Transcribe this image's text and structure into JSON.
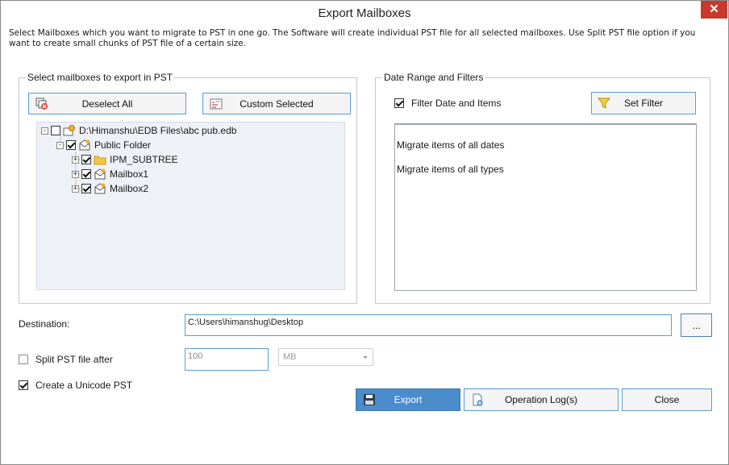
{
  "window": {
    "title": "Export Mailboxes",
    "close_glyph": "✕"
  },
  "description": "Select Mailboxes which you want to migrate to PST in one go. The Software will create individual PST file for all selected mailboxes. Use Split PST file option if you want to create small chunks of PST file of a certain size.",
  "left_group": {
    "legend": "Select mailboxes to export in PST",
    "deselect_label": "Deselect All",
    "deselect_icon": "deselect-icon",
    "custom_label": "Custom Selected",
    "custom_icon": "custom-select-icon",
    "tree": [
      {
        "label": "D:\\Himanshu\\EDB Files\\abc pub.edb",
        "expander": "-",
        "checked": false,
        "icon": "database-icon"
      },
      {
        "label": "Public Folder",
        "expander": "-",
        "checked": true,
        "icon": "mailbox-icon"
      },
      {
        "label": "IPM_SUBTREE",
        "expander": "+",
        "checked": true,
        "icon": "folder-icon"
      },
      {
        "label": "Mailbox1",
        "expander": "+",
        "checked": true,
        "icon": "mailbox-icon"
      },
      {
        "label": "Mailbox2",
        "expander": "+",
        "checked": true,
        "icon": "mailbox-icon"
      }
    ]
  },
  "right_group": {
    "legend": "Date Range and Filters",
    "filter_checkbox_label": "Filter Date and Items",
    "filter_checked": true,
    "set_filter_label": "Set Filter",
    "set_filter_icon": "funnel-icon",
    "filter_lines": [
      "Migrate items of all dates",
      "Migrate items of all types"
    ]
  },
  "destination": {
    "label": "Destination:",
    "value": "C:\\Users\\himanshug\\Desktop",
    "browse_label": "..."
  },
  "split": {
    "label": "Split PST file after",
    "checked": false,
    "size_value": "100",
    "unit_value": "MB"
  },
  "unicode": {
    "label": "Create a Unicode PST",
    "checked": true
  },
  "buttons": {
    "export_label": "Export",
    "export_icon": "save-icon",
    "log_label": "Operation Log(s)",
    "log_icon": "log-file-icon",
    "close_label": "Close"
  },
  "colors": {
    "accent": "#5b9bd5",
    "export_bg": "#4a8ccc",
    "close_red": "#c7392a",
    "tree_bg": "#eef1f7"
  }
}
